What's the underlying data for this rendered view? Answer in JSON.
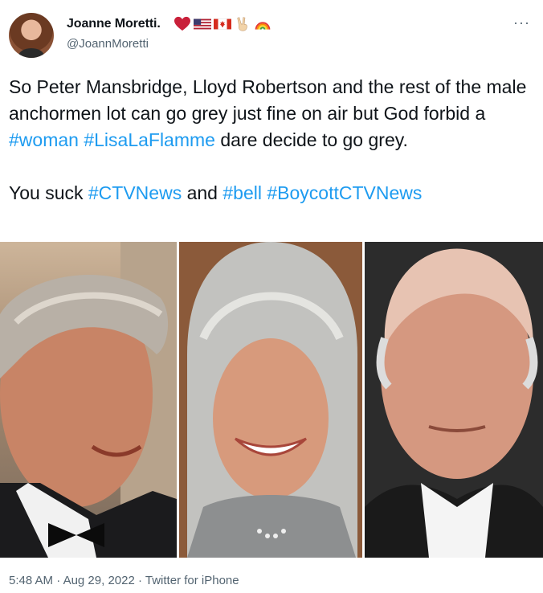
{
  "author": {
    "display_name": "Joanne Moretti.",
    "handle": "@JoannMoretti",
    "emojis": [
      "heart-emoji",
      "us-flag-emoji",
      "canada-flag-emoji",
      "victory-hand-emoji",
      "rainbow-emoji"
    ]
  },
  "more_label": "···",
  "tweet": {
    "lines": [
      {
        "segments": [
          {
            "text": "So Peter Mansbridge, Lloyd Robertson and the rest of the male anchormen lot can go grey just fine on air but God forbid a ",
            "type": "text"
          },
          {
            "text": "#woman",
            "type": "hashtag"
          },
          {
            "text": " ",
            "type": "text"
          },
          {
            "text": "#LisaLaFlamme",
            "type": "hashtag"
          },
          {
            "text": " dare decide to go grey.",
            "type": "text"
          }
        ]
      },
      {
        "segments": [
          {
            "text": "You suck ",
            "type": "text"
          },
          {
            "text": "#CTVNews",
            "type": "hashtag"
          },
          {
            "text": " and ",
            "type": "text"
          },
          {
            "text": "#bell",
            "type": "hashtag"
          },
          {
            "text": " ",
            "type": "text"
          },
          {
            "text": "#BoycottCTVNews",
            "type": "hashtag"
          }
        ]
      }
    ]
  },
  "meta": {
    "time": "5:48 AM",
    "separator": "·",
    "date": "Aug 29, 2022",
    "client": "Twitter for iPhone"
  },
  "colors": {
    "hashtag": "#1d9bf0",
    "secondary": "#536471",
    "text": "#0f1419"
  }
}
